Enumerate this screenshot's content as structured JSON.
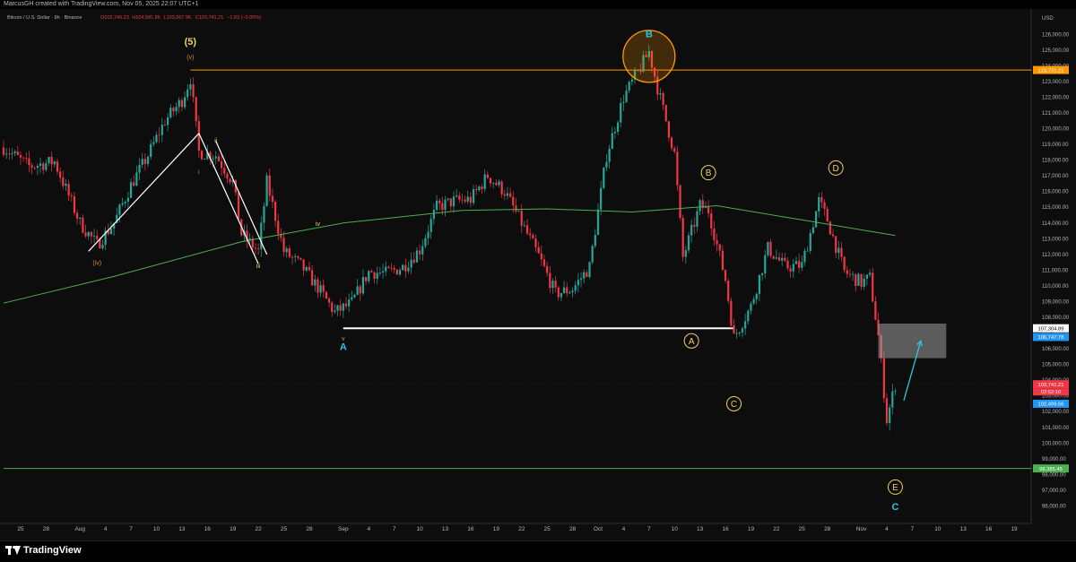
{
  "header": {
    "creator": "MarcusGH created with TradingView.com, Nov 05, 2025 22:07 UTC+1",
    "symbol": "Bitcoin / U.S. Dollar · 8h · Binance",
    "ohlc_open": "O103,746.23",
    "ohlc_high": "H104,581.86",
    "ohlc_low": "L103,067.96",
    "ohlc_close": "C103,741.21",
    "change": "−1.83 (−0.00%)"
  },
  "footer": {
    "logo_text": "TradingView"
  },
  "colors": {
    "up": "#26a69a",
    "down": "#f23645",
    "background": "#0d0d0d",
    "ema": "#4caf50",
    "resistance": "#ff9800",
    "support": "#4caf50",
    "wave_yellow": "#f0d060",
    "wave_cyan": "#2cc6e0",
    "wave_orange": "#e08a2c"
  },
  "chart_data": {
    "type": "candlestick",
    "currency": "USD",
    "timeframe": "8h",
    "ylim": [
      95000,
      127500
    ],
    "y_ticks": [
      96000,
      97000,
      98000,
      99000,
      100000,
      101000,
      102000,
      103000,
      104000,
      105000,
      106000,
      107000,
      108000,
      109000,
      110000,
      111000,
      112000,
      113000,
      114000,
      115000,
      116000,
      117000,
      118000,
      119000,
      120000,
      121000,
      122000,
      123000,
      124000,
      125000,
      126000,
      127000
    ],
    "y_tick_labels": [
      "96,000.00",
      "97,000.00",
      "98,000.00",
      "99,000.00",
      "100,000.00",
      "101,000.00",
      "102,000.00",
      "103,000.00",
      "104,000.00",
      "105,000.00",
      "106,000.00",
      "107,000.00",
      "108,000.00",
      "109,000.00",
      "110,000.00",
      "111,000.00",
      "112,000.00",
      "113,000.00",
      "114,000.00",
      "115,000.00",
      "116,000.00",
      "117,000.00",
      "118,000.00",
      "119,000.00",
      "120,000.00",
      "121,000.00",
      "122,000.00",
      "123,000.00",
      "124,000.00",
      "125,000.00",
      "126,000.00",
      "127,000.00"
    ],
    "x_ticks": [
      {
        "date": "2025-07-25",
        "label": "25"
      },
      {
        "date": "2025-07-28",
        "label": "28"
      },
      {
        "date": "2025-08-01",
        "label": "Aug"
      },
      {
        "date": "2025-08-04",
        "label": "4"
      },
      {
        "date": "2025-08-07",
        "label": "7"
      },
      {
        "date": "2025-08-10",
        "label": "10"
      },
      {
        "date": "2025-08-13",
        "label": "13"
      },
      {
        "date": "2025-08-16",
        "label": "16"
      },
      {
        "date": "2025-08-19",
        "label": "19"
      },
      {
        "date": "2025-08-22",
        "label": "22"
      },
      {
        "date": "2025-08-25",
        "label": "25"
      },
      {
        "date": "2025-08-28",
        "label": "28"
      },
      {
        "date": "2025-09-01",
        "label": "Sep"
      },
      {
        "date": "2025-09-04",
        "label": "4"
      },
      {
        "date": "2025-09-07",
        "label": "7"
      },
      {
        "date": "2025-09-10",
        "label": "10"
      },
      {
        "date": "2025-09-13",
        "label": "13"
      },
      {
        "date": "2025-09-16",
        "label": "16"
      },
      {
        "date": "2025-09-19",
        "label": "19"
      },
      {
        "date": "2025-09-22",
        "label": "22"
      },
      {
        "date": "2025-09-25",
        "label": "25"
      },
      {
        "date": "2025-09-28",
        "label": "28"
      },
      {
        "date": "2025-10-01",
        "label": "Oct"
      },
      {
        "date": "2025-10-04",
        "label": "4"
      },
      {
        "date": "2025-10-07",
        "label": "7"
      },
      {
        "date": "2025-10-10",
        "label": "10"
      },
      {
        "date": "2025-10-13",
        "label": "13"
      },
      {
        "date": "2025-10-16",
        "label": "16"
      },
      {
        "date": "2025-10-19",
        "label": "19"
      },
      {
        "date": "2025-10-22",
        "label": "22"
      },
      {
        "date": "2025-10-25",
        "label": "25"
      },
      {
        "date": "2025-10-28",
        "label": "28"
      },
      {
        "date": "2025-11-01",
        "label": "Nov"
      },
      {
        "date": "2025-11-04",
        "label": "4"
      },
      {
        "date": "2025-11-07",
        "label": "7"
      },
      {
        "date": "2025-11-10",
        "label": "10"
      },
      {
        "date": "2025-11-13",
        "label": "13"
      },
      {
        "date": "2025-11-16",
        "label": "16"
      },
      {
        "date": "2025-11-19",
        "label": "19"
      }
    ],
    "xlim": [
      "2025-07-23",
      "2025-11-21"
    ],
    "series": [
      {
        "name": "BTCUSD close (approx.)",
        "points": [
          [
            "2025-07-23",
            118800
          ],
          [
            "2025-07-26",
            117600
          ],
          [
            "2025-07-29",
            117900
          ],
          [
            "2025-08-01",
            114000
          ],
          [
            "2025-08-03",
            112600
          ],
          [
            "2025-08-05",
            114000
          ],
          [
            "2025-08-07",
            116400
          ],
          [
            "2025-08-09",
            118300
          ],
          [
            "2025-08-11",
            120500
          ],
          [
            "2025-08-13",
            121800
          ],
          [
            "2025-08-14",
            123200
          ],
          [
            "2025-08-15",
            118500
          ],
          [
            "2025-08-17",
            118300
          ],
          [
            "2025-08-19",
            116600
          ],
          [
            "2025-08-20",
            113300
          ],
          [
            "2025-08-22",
            112200
          ],
          [
            "2025-08-23",
            116600
          ],
          [
            "2025-08-25",
            112200
          ],
          [
            "2025-08-27",
            111300
          ],
          [
            "2025-08-29",
            109900
          ],
          [
            "2025-08-31",
            108300
          ],
          [
            "2025-09-02",
            108900
          ],
          [
            "2025-09-04",
            110900
          ],
          [
            "2025-09-06",
            110800
          ],
          [
            "2025-09-08",
            111200
          ],
          [
            "2025-09-10",
            112300
          ],
          [
            "2025-09-12",
            115000
          ],
          [
            "2025-09-14",
            115400
          ],
          [
            "2025-09-16",
            115500
          ],
          [
            "2025-09-18",
            117000
          ],
          [
            "2025-09-20",
            116000
          ],
          [
            "2025-09-22",
            114000
          ],
          [
            "2025-09-24",
            111900
          ],
          [
            "2025-09-26",
            109500
          ],
          [
            "2025-09-28",
            109800
          ],
          [
            "2025-09-30",
            111200
          ],
          [
            "2025-10-02",
            118300
          ],
          [
            "2025-10-04",
            122000
          ],
          [
            "2025-10-06",
            123900
          ],
          [
            "2025-10-07",
            124900
          ],
          [
            "2025-10-08",
            122600
          ],
          [
            "2025-10-10",
            118400
          ],
          [
            "2025-10-11",
            111800
          ],
          [
            "2025-10-13",
            115100
          ],
          [
            "2025-10-14",
            114800
          ],
          [
            "2025-10-16",
            110400
          ],
          [
            "2025-10-17",
            106700
          ],
          [
            "2025-10-19",
            108700
          ],
          [
            "2025-10-21",
            112400
          ],
          [
            "2025-10-23",
            111200
          ],
          [
            "2025-10-25",
            111300
          ],
          [
            "2025-10-27",
            115400
          ],
          [
            "2025-10-28",
            114200
          ],
          [
            "2025-10-30",
            110900
          ],
          [
            "2025-11-01",
            110200
          ],
          [
            "2025-11-02",
            110500
          ],
          [
            "2025-11-03",
            106800
          ],
          [
            "2025-11-04",
            101500
          ],
          [
            "2025-11-05",
            103741
          ]
        ]
      },
      {
        "name": "EMA (approx.)",
        "points": [
          [
            "2025-07-23",
            108900
          ],
          [
            "2025-08-05",
            110600
          ],
          [
            "2025-08-20",
            112800
          ],
          [
            "2025-09-01",
            114000
          ],
          [
            "2025-09-15",
            114800
          ],
          [
            "2025-09-25",
            114900
          ],
          [
            "2025-10-05",
            114700
          ],
          [
            "2025-10-15",
            115100
          ],
          [
            "2025-10-25",
            114200
          ],
          [
            "2025-11-05",
            113200
          ]
        ]
      }
    ],
    "price_labels": [
      {
        "value": 123731.21,
        "label": "123,731.21",
        "color": "#ff9800"
      },
      {
        "value": 107304.89,
        "label": "107,304.89",
        "color": "#ffffff"
      },
      {
        "value": 106747.78,
        "label": "106,747.78",
        "color": "#2196f3"
      },
      {
        "value": 103741.21,
        "label": "103,741.21",
        "color": "#f23645"
      },
      {
        "value": 102499.56,
        "label": "102,499.56",
        "color": "#2196f3"
      },
      {
        "value": 98385.45,
        "label": "98,385.45",
        "color": "#4caf50"
      }
    ],
    "countdown": "02:52:10",
    "horizontal_lines": [
      {
        "value": 123731.21,
        "from": "2025-08-14",
        "to": "2025-11-21",
        "color": "#ff9800"
      },
      {
        "value": 107304.89,
        "from": "2025-09-01",
        "to": "2025-10-17",
        "color": "#ffffff"
      },
      {
        "value": 98385.45,
        "from": "2025-07-23",
        "to": "2025-11-21",
        "color": "#4caf50"
      }
    ],
    "wave_labels": [
      {
        "text": "(5)",
        "date": "2025-08-14",
        "value": 125500,
        "color": "#f0d060"
      },
      {
        "text": "(v)",
        "date": "2025-08-14",
        "value": 124600,
        "color": "#e08a2c"
      },
      {
        "text": "(iv)",
        "date": "2025-08-03",
        "value": 111500,
        "color": "#e08a2c"
      },
      {
        "text": "i",
        "date": "2025-08-15",
        "value": 117300,
        "color": "#e08a2c"
      },
      {
        "text": "ii",
        "date": "2025-08-17",
        "value": 119300,
        "color": "#f0d060"
      },
      {
        "text": "iii",
        "date": "2025-08-22",
        "value": 111300,
        "color": "#f0d060"
      },
      {
        "text": "iv",
        "date": "2025-08-29",
        "value": 114000,
        "color": "#f0d060"
      },
      {
        "text": "v",
        "date": "2025-09-01",
        "value": 106700,
        "color": "#e08a2c"
      },
      {
        "text": "A",
        "date": "2025-09-01",
        "value": 106100,
        "color": "#2cc6e0"
      },
      {
        "text": "B",
        "date": "2025-10-07",
        "value": 126000,
        "color": "#2cc6e0"
      },
      {
        "text": "B",
        "date": "2025-10-14",
        "value": 117200,
        "color": "#f0d060",
        "circled": true
      },
      {
        "text": "A",
        "date": "2025-10-12",
        "value": 106500,
        "color": "#f0d060",
        "circled": true
      },
      {
        "text": "C",
        "date": "2025-10-17",
        "value": 102500,
        "color": "#f0d060",
        "circled": true
      },
      {
        "text": "D",
        "date": "2025-10-29",
        "value": 117500,
        "color": "#f0d060",
        "circled": true
      },
      {
        "text": "E",
        "date": "2025-11-05",
        "value": 97200,
        "color": "#f0d060",
        "circled": true
      },
      {
        "text": "C",
        "date": "2025-11-05",
        "value": 95900,
        "color": "#2cc6e0"
      }
    ],
    "annotation_lines": [
      {
        "from": [
          "2025-08-02",
          112200
        ],
        "to": [
          "2025-08-15",
          119700
        ],
        "color": "#ffffff"
      },
      {
        "from": [
          "2025-08-15",
          119700
        ],
        "to": [
          "2025-08-22",
          111400
        ],
        "color": "#ffffff"
      },
      {
        "from": [
          "2025-08-17",
          119200
        ],
        "to": [
          "2025-08-23",
          112000
        ],
        "color": "#ffffff"
      }
    ],
    "projection_box": {
      "from": [
        "2025-11-03",
        107600
      ],
      "to": [
        "2025-11-11",
        105400
      ],
      "color": "#9e9e9e"
    },
    "projection_arrow": {
      "from": [
        "2025-11-06",
        102700
      ],
      "to": [
        "2025-11-08",
        106500
      ],
      "color": "#2cc6e0"
    },
    "highlight_circle": {
      "center": [
        "2025-10-07",
        124600
      ],
      "color": "#ff9800"
    }
  }
}
